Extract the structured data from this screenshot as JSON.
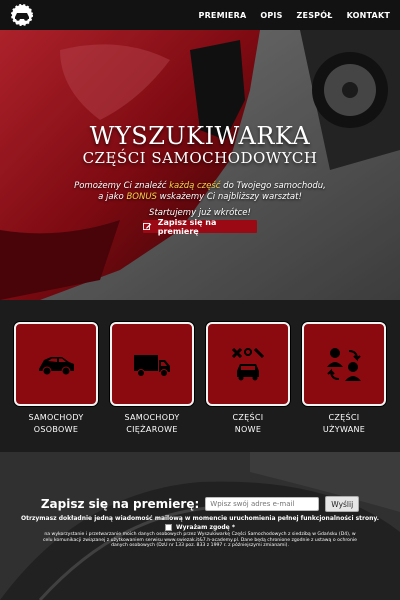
{
  "nav": {
    "logo_icon": "car-gear-logo-icon",
    "links": [
      "PREMIERA",
      "OPIS",
      "ZESPÓŁ",
      "KONTAKT"
    ]
  },
  "hero": {
    "title": "WYSZUKIWARKA",
    "subtitle": "CZĘŚCI SAMOCHODOWYCH",
    "desc_line1_a": "Pomożemy Ci znaleźć ",
    "desc_line1_hl": "każdą część",
    "desc_line1_b": " do Twojego samochodu,",
    "desc_line2_a": "a jako ",
    "desc_line2_hl": "BONUS",
    "desc_line2_b": " wskażemy Ci najbliższy warsztat!",
    "soon": "Startujemy już wkrótce!",
    "button": "Zapisz się na premierę",
    "button_icon": "edit-icon"
  },
  "categories": [
    {
      "line1": "SAMOCHODY",
      "line2": "OSOBOWE",
      "icon": "car-icon"
    },
    {
      "line1": "SAMOCHODY",
      "line2": "CIĘŻAROWE",
      "icon": "truck-icon"
    },
    {
      "line1": "CZĘŚCI",
      "line2": "NOWE",
      "icon": "tools-car-icon"
    },
    {
      "line1": "CZĘŚCI",
      "line2": "UŻYWANE",
      "icon": "exchange-users-icon"
    }
  ],
  "signup": {
    "title": "Zapisz się na premierę:",
    "placeholder": "Wpisz swój adres e-mail",
    "button": "Wyślij",
    "info": "Otrzymasz dokładnie jedną wiadomość mailową w momencie uruchomienia pełnej funkcjonalności strony.",
    "consent": "Wyrażam zgodę *",
    "legal": "na wykorzystanie i przetwarzanie moich danych osobowych przez Wyszukiwarkę Części Samochodowych z siedzibą w Gdańsku (D4), w celu komunikacji związanej z użytkowaniem serwisu www.swiezak.it&7.h-academy.pl. Dane będą chronione zgodnie z ustawą o ochronie danych osobowych (DzU nr 133 poz. 833 z 1997 r. z późniejszymi zmianami)."
  },
  "colors": {
    "accent": "#9b0a14",
    "tile": "#8b0a10",
    "highlight": "#ffd34a",
    "nav_bg": "#121212"
  }
}
